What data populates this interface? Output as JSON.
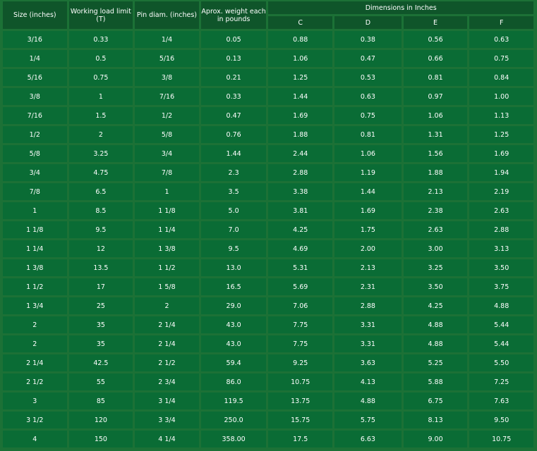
{
  "headers": {
    "size": "Size (inches)",
    "wll": "Working load limit (T)",
    "pin": "Pin diam. (inches)",
    "weight": "Aprox. weight each in pounds",
    "dimensions": "Dimensions in Inches",
    "c": "C",
    "d": "D",
    "e": "E",
    "f": "F"
  },
  "rows": [
    [
      "3/16",
      "0.33",
      "1/4",
      "0.05",
      "0.88",
      "0.38",
      "0.56",
      "0.63"
    ],
    [
      "1/4",
      "0.5",
      "5/16",
      "0.13",
      "1.06",
      "0.47",
      "0.66",
      "0.75"
    ],
    [
      "5/16",
      "0.75",
      "3/8",
      "0.21",
      "1.25",
      "0.53",
      "0.81",
      "0.84"
    ],
    [
      "3/8",
      "1",
      "7/16",
      "0.33",
      "1.44",
      "0.63",
      "0.97",
      "1.00"
    ],
    [
      "7/16",
      "1.5",
      "1/2",
      "0.47",
      "1.69",
      "0.75",
      "1.06",
      "1.13"
    ],
    [
      "1/2",
      "2",
      "5/8",
      "0.76",
      "1.88",
      "0.81",
      "1.31",
      "1.25"
    ],
    [
      "5/8",
      "3.25",
      "3/4",
      "1.44",
      "2.44",
      "1.06",
      "1.56",
      "1.69"
    ],
    [
      "3/4",
      "4.75",
      "7/8",
      "2.3",
      "2.88",
      "1.19",
      "1.88",
      "1.94"
    ],
    [
      "7/8",
      "6.5",
      "1",
      "3.5",
      "3.38",
      "1.44",
      "2.13",
      "2.19"
    ],
    [
      "1",
      "8.5",
      "1 1/8",
      "5.0",
      "3.81",
      "1.69",
      "2.38",
      "2.63"
    ],
    [
      "1 1/8",
      "9.5",
      "1 1/4",
      "7.0",
      "4.25",
      "1.75",
      "2.63",
      "2.88"
    ],
    [
      "1 1/4",
      "12",
      "1 3/8",
      "9.5",
      "4.69",
      "2.00",
      "3.00",
      "3.13"
    ],
    [
      "1 3/8",
      "13.5",
      "1 1/2",
      "13.0",
      "5.31",
      "2.13",
      "3.25",
      "3.50"
    ],
    [
      "1 1/2",
      "17",
      "1 5/8",
      "16.5",
      "5.69",
      "2.31",
      "3.50",
      "3.75"
    ],
    [
      "1 3/4",
      "25",
      "2",
      "29.0",
      "7.06",
      "2.88",
      "4.25",
      "4.88"
    ],
    [
      "2",
      "35",
      "2 1/4",
      "43.0",
      "7.75",
      "3.31",
      "4.88",
      "5.44"
    ],
    [
      "2",
      "35",
      "2 1/4",
      "43.0",
      "7.75",
      "3.31",
      "4.88",
      "5.44"
    ],
    [
      "2 1/4",
      "42.5",
      "2 1/2",
      "59.4",
      "9.25",
      "3.63",
      "5.25",
      "5.50"
    ],
    [
      "2 1/2",
      "55",
      "2 3/4",
      "86.0",
      "10.75",
      "4.13",
      "5.88",
      "7.25"
    ],
    [
      "3",
      "85",
      "3 1/4",
      "119.5",
      "13.75",
      "4.88",
      "6.75",
      "7.63"
    ],
    [
      "3 1/2",
      "120",
      "3 3/4",
      "250.0",
      "15.75",
      "5.75",
      "8.13",
      "9.50"
    ],
    [
      "4",
      "150",
      "4 1/4",
      "358.00",
      "17.5",
      "6.63",
      "9.00",
      "10.75"
    ]
  ]
}
